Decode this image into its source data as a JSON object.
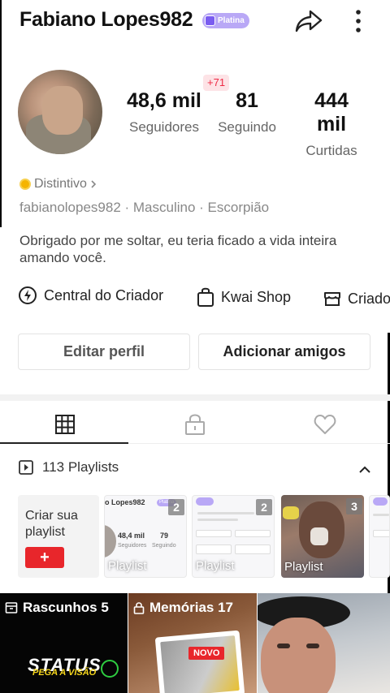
{
  "header": {
    "username": "Fabiano Lopes982",
    "badge": "Platina"
  },
  "stats": {
    "notification": "+71",
    "followers": {
      "value": "48,6 mil",
      "label": "Seguidores"
    },
    "following": {
      "value": "81",
      "label": "Seguindo"
    },
    "likes": {
      "value": "444 mil",
      "label": "Curtidas"
    }
  },
  "profile": {
    "distintivo": "Distintivo",
    "meta": "fabianolopes982 · Masculino · Escorpião",
    "bio": "Obrigado por me soltar, eu teria ficado a vida inteira amando você."
  },
  "shortcuts": [
    {
      "label": "Central do Criador",
      "icon": "lightning-icon"
    },
    {
      "label": "Kwai Shop",
      "icon": "shopping-bag-icon"
    },
    {
      "label": "Criado",
      "icon": "store-icon"
    }
  ],
  "buttons": {
    "edit_profile": "Editar perfil",
    "add_friends": "Adicionar amigos"
  },
  "tabs": [
    {
      "name": "grid",
      "icon": "grid-icon",
      "active": true
    },
    {
      "name": "private",
      "icon": "lock-icon",
      "active": false
    },
    {
      "name": "liked",
      "icon": "heart-icon",
      "active": false
    }
  ],
  "playlists": {
    "title": "113 Playlists",
    "create_label": "Criar sua playlist",
    "cards": [
      {
        "count": "2",
        "label": "Playlist",
        "mini_name": "o Lopes982",
        "mini_badge": "Platina",
        "mini_stat1": "48,4 mil",
        "mini_stat2": "79",
        "mini_lbl1": "Seguidores",
        "mini_lbl2": "Seguindo"
      },
      {
        "count": "2",
        "label": "Playlist"
      },
      {
        "count": "3",
        "label": "Playlist"
      }
    ]
  },
  "grid": {
    "drafts": "Rascunhos 5",
    "memories": "Memórias 17",
    "status_logo": "STATUS",
    "status_sub": "PEGA A VISÃO",
    "novo": "NOVO"
  },
  "colors": {
    "accent_red": "#e8262b",
    "badge_purple": "#b9a8f6",
    "notification_red": "#ee2a45"
  }
}
